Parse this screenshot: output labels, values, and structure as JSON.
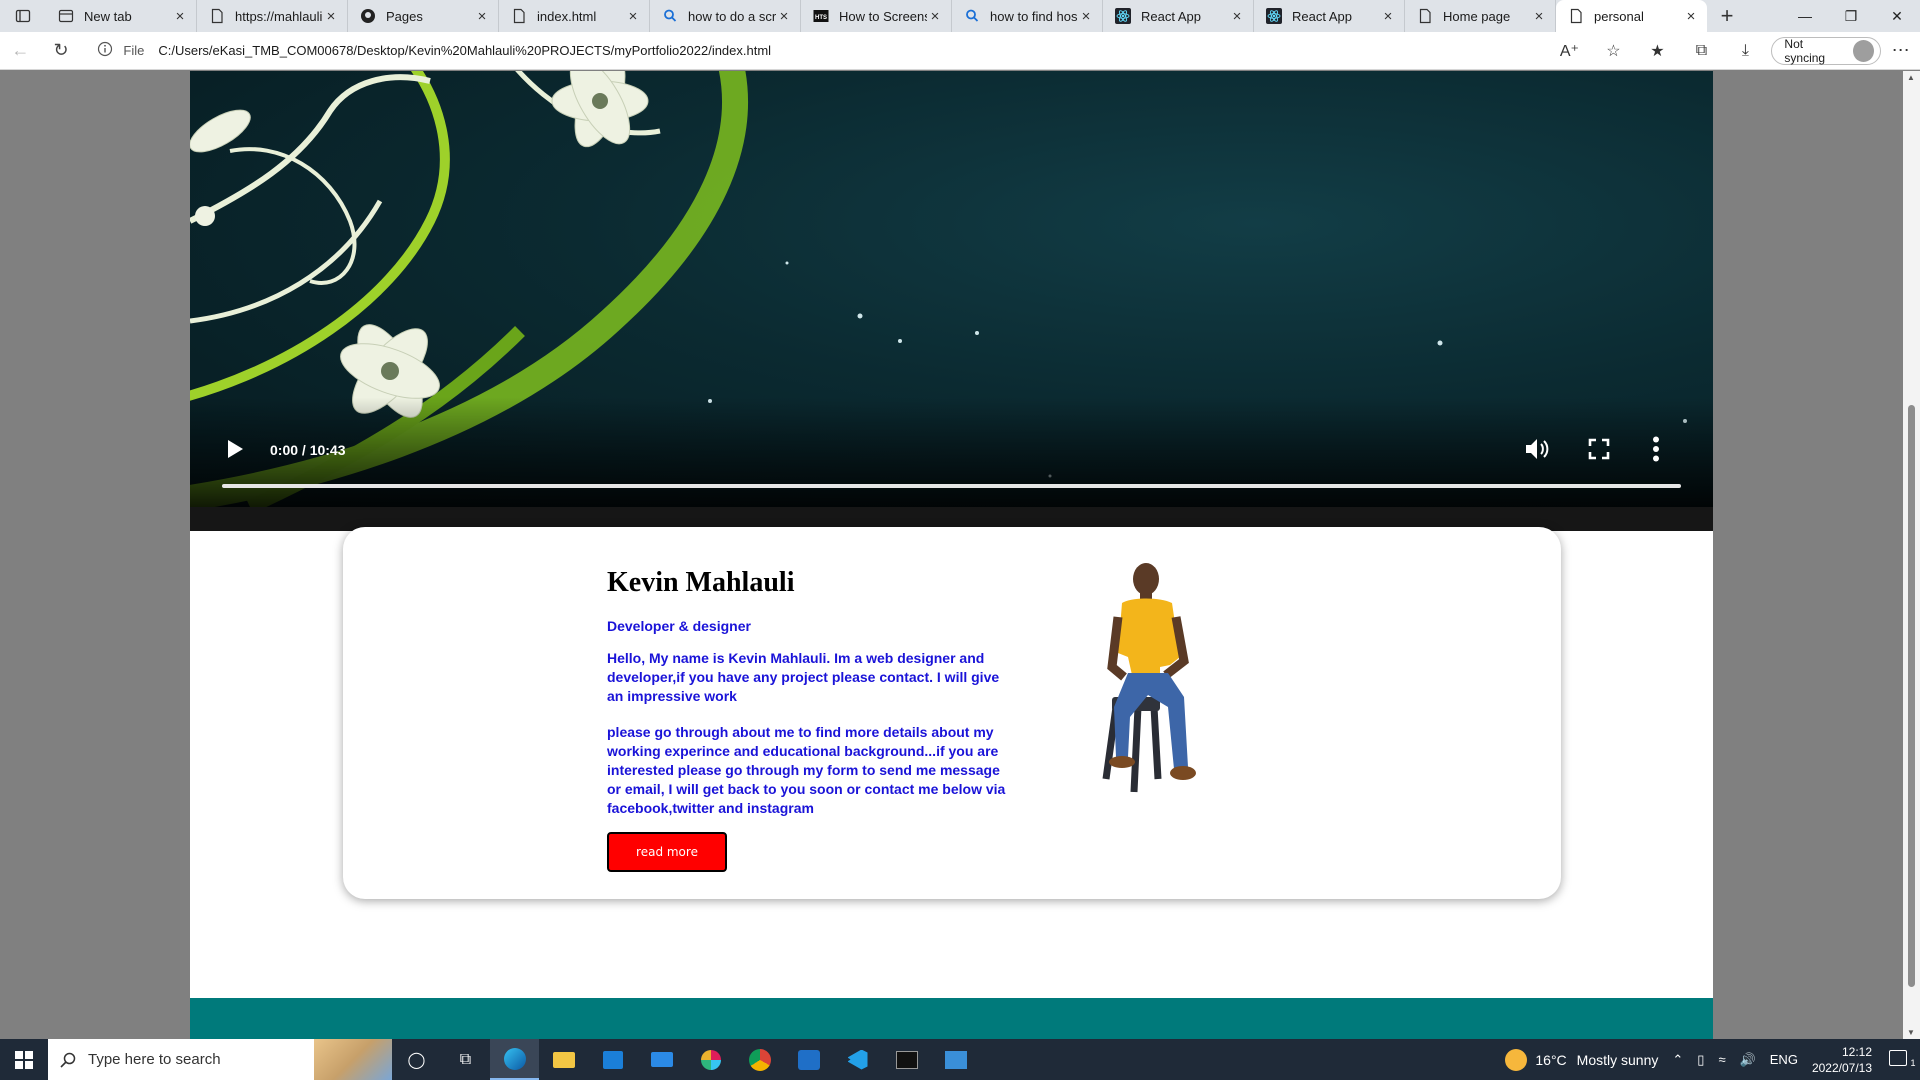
{
  "browser": {
    "tabs": [
      {
        "title": "New tab",
        "icon": "new-tab-icon"
      },
      {
        "title": "https://mahlauli",
        "icon": "page-icon"
      },
      {
        "title": "Pages",
        "icon": "github-icon"
      },
      {
        "title": "index.html",
        "icon": "page-icon"
      },
      {
        "title": "how to do a scr",
        "icon": "search-icon"
      },
      {
        "title": "How to Screens",
        "icon": "hts-icon"
      },
      {
        "title": "how to find hos",
        "icon": "search-icon"
      },
      {
        "title": "React App",
        "icon": "react-icon"
      },
      {
        "title": "React App",
        "icon": "react-icon"
      },
      {
        "title": "Home page",
        "icon": "page-icon"
      },
      {
        "title": "personal",
        "icon": "page-icon",
        "active": true
      }
    ],
    "address": {
      "scheme_label": "File",
      "url": "C:/Users/eKasi_TMB_COM00678/Desktop/Kevin%20Mahlauli%20PROJECTS/myPortfolio2022/index.html"
    },
    "sync_label": "Not syncing"
  },
  "video": {
    "time": "0:00 / 10:43"
  },
  "profile": {
    "name": "Kevin Mahlauli",
    "role": "Developer & designer",
    "intro": "Hello, My name is Kevin Mahlauli. Im a web designer and developer,if you have any project please contact. I will give an impressive work",
    "details": "please go through about me to find more details about my working experince and educational background...if you are interested please go through my form to send me message or email, I will get back to you soon or contact me below via facebook,twitter and instagram",
    "button": "read more"
  },
  "taskbar": {
    "search_placeholder": "Type here to search",
    "weather_temp": "16°C",
    "weather_desc": "Mostly sunny",
    "language": "ENG",
    "time": "12:12",
    "date": "2022/07/13",
    "notification_count": "1"
  },
  "colors": {
    "accent_text": "#1a13d8",
    "button_bg": "#ff0000",
    "footer_band": "#007a7b"
  }
}
